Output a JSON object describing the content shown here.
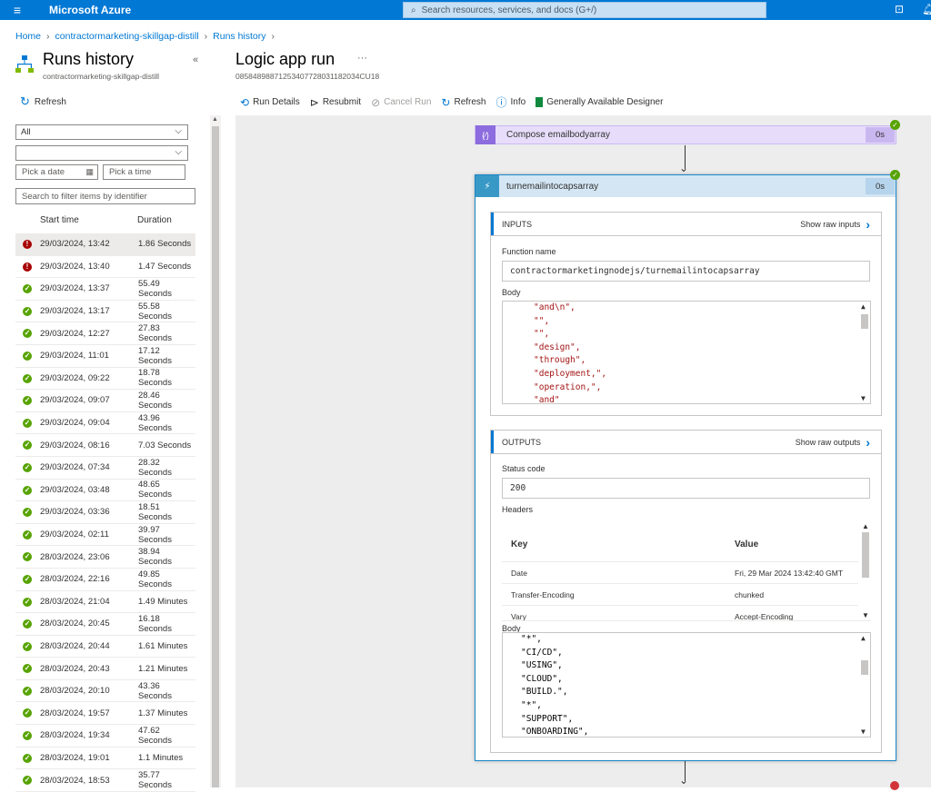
{
  "topbar": {
    "brand": "Microsoft Azure",
    "search_placeholder": "Search resources, services, and docs (G+/)"
  },
  "breadcrumb": [
    "Home",
    "contractormarketing-skillgap-distill",
    "Runs history"
  ],
  "left_panel": {
    "title": "Runs history",
    "subtitle": "contractormarketing-skillgap-distill",
    "refresh_label": "Refresh",
    "status_filter": "All",
    "second_filter": "",
    "date_placeholder": "Pick a date",
    "time_placeholder": "Pick a time",
    "filter_placeholder": "Search to filter items by identifier",
    "col_start": "Start time",
    "col_duration": "Duration",
    "runs": [
      {
        "status": "error",
        "time": "29/03/2024, 13:42",
        "duration": "1.86 Seconds"
      },
      {
        "status": "error",
        "time": "29/03/2024, 13:40",
        "duration": "1.47 Seconds"
      },
      {
        "status": "ok",
        "time": "29/03/2024, 13:37",
        "duration": "55.49 Seconds"
      },
      {
        "status": "ok",
        "time": "29/03/2024, 13:17",
        "duration": "55.58 Seconds"
      },
      {
        "status": "ok",
        "time": "29/03/2024, 12:27",
        "duration": "27.83 Seconds"
      },
      {
        "status": "ok",
        "time": "29/03/2024, 11:01",
        "duration": "17.12 Seconds"
      },
      {
        "status": "ok",
        "time": "29/03/2024, 09:22",
        "duration": "18.78 Seconds"
      },
      {
        "status": "ok",
        "time": "29/03/2024, 09:07",
        "duration": "28.46 Seconds"
      },
      {
        "status": "ok",
        "time": "29/03/2024, 09:04",
        "duration": "43.96 Seconds"
      },
      {
        "status": "ok",
        "time": "29/03/2024, 08:16",
        "duration": "7.03 Seconds"
      },
      {
        "status": "ok",
        "time": "29/03/2024, 07:34",
        "duration": "28.32 Seconds"
      },
      {
        "status": "ok",
        "time": "29/03/2024, 03:48",
        "duration": "48.65 Seconds"
      },
      {
        "status": "ok",
        "time": "29/03/2024, 03:36",
        "duration": "18.51 Seconds"
      },
      {
        "status": "ok",
        "time": "29/03/2024, 02:11",
        "duration": "39.97 Seconds"
      },
      {
        "status": "ok",
        "time": "28/03/2024, 23:06",
        "duration": "38.94 Seconds"
      },
      {
        "status": "ok",
        "time": "28/03/2024, 22:16",
        "duration": "49.85 Seconds"
      },
      {
        "status": "ok",
        "time": "28/03/2024, 21:04",
        "duration": "1.49 Minutes"
      },
      {
        "status": "ok",
        "time": "28/03/2024, 20:45",
        "duration": "16.18 Seconds"
      },
      {
        "status": "ok",
        "time": "28/03/2024, 20:44",
        "duration": "1.61 Minutes"
      },
      {
        "status": "ok",
        "time": "28/03/2024, 20:43",
        "duration": "1.21 Minutes"
      },
      {
        "status": "ok",
        "time": "28/03/2024, 20:10",
        "duration": "43.36 Seconds"
      },
      {
        "status": "ok",
        "time": "28/03/2024, 19:57",
        "duration": "1.37 Minutes"
      },
      {
        "status": "ok",
        "time": "28/03/2024, 19:34",
        "duration": "47.62 Seconds"
      },
      {
        "status": "ok",
        "time": "28/03/2024, 19:01",
        "duration": "1.1 Minutes"
      },
      {
        "status": "ok",
        "time": "28/03/2024, 18:53",
        "duration": "35.77 Seconds"
      }
    ]
  },
  "main": {
    "title": "Logic app run",
    "run_id": "08584898871253407728031182034CU18",
    "toolbar": {
      "run_details": "Run Details",
      "resubmit": "Resubmit",
      "cancel_run": "Cancel Run",
      "refresh": "Refresh",
      "info": "Info",
      "designer": "Generally Available Designer"
    },
    "compose_card": {
      "label": "Compose emailbodyarray",
      "duration": "0s"
    },
    "function_card": {
      "label": "turnemailintocapsarray",
      "duration": "0s",
      "inputs_title": "INPUTS",
      "show_raw_inputs": "Show raw inputs",
      "function_name_label": "Function name",
      "function_name": "contractormarketingnodejs/turnemailintocapsarray",
      "body_label": "Body",
      "input_body_lines": [
        "\"and\\n\",",
        "\"\",",
        "\"\",",
        "\"design\",",
        "\"through\",",
        "\"deployment,\",",
        "\"operation,\",",
        "\"and\""
      ],
      "outputs_title": "OUTPUTS",
      "show_raw_outputs": "Show raw outputs",
      "status_code_label": "Status code",
      "status_code": "200",
      "headers_label": "Headers",
      "headers_key_col": "Key",
      "headers_value_col": "Value",
      "headers": [
        {
          "key": "Date",
          "value": "Fri, 29 Mar 2024 13:42:40 GMT"
        },
        {
          "key": "Transfer-Encoding",
          "value": "chunked"
        },
        {
          "key": "Vary",
          "value": "Accept-Encoding"
        }
      ],
      "output_body_label": "Body",
      "output_body_lines": [
        "\"*\",",
        "\"CI/CD\",",
        "\"USING\",",
        "\"CLOUD\",",
        "\"BUILD.\",",
        "\"*\",",
        "\"SUPPORT\",",
        "\"ONBOARDING\","
      ]
    }
  }
}
